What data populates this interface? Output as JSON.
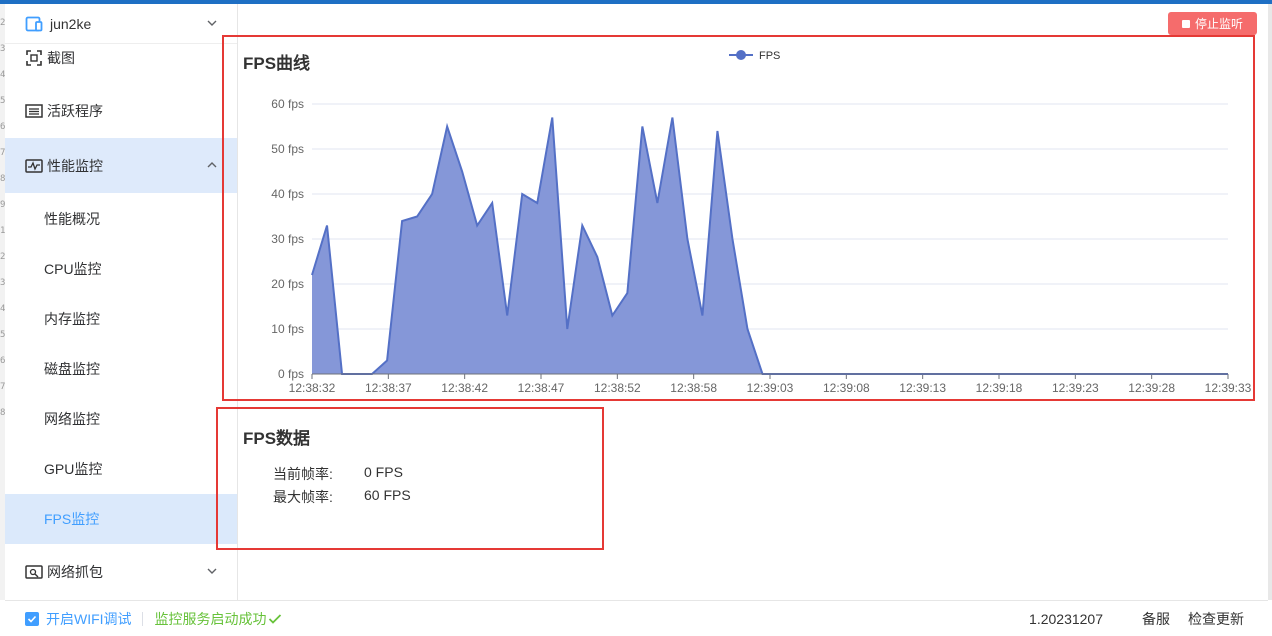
{
  "app": {
    "device_name": "jun2ke",
    "gutter_numbers": [
      "2",
      "3",
      "4",
      "5",
      "6",
      "7",
      "8",
      "9",
      "1",
      "2",
      "3",
      "4",
      "5",
      "6",
      "7",
      "8"
    ]
  },
  "sidebar": {
    "items": [
      {
        "label": "截图",
        "icon": "screenshot-icon"
      },
      {
        "label": "活跃程序",
        "icon": "list-icon"
      },
      {
        "label": "性能监控",
        "icon": "pulse-icon",
        "expanded": true
      },
      {
        "label": "网络抓包",
        "icon": "capture-icon"
      }
    ],
    "subitems": [
      {
        "label": "性能概况"
      },
      {
        "label": "CPU监控"
      },
      {
        "label": "内存监控"
      },
      {
        "label": "磁盘监控"
      },
      {
        "label": "网络监控"
      },
      {
        "label": "GPU监控"
      },
      {
        "label": "FPS监控",
        "active": true
      }
    ]
  },
  "toolbar": {
    "stop_label": "停止监听"
  },
  "chart_panel": {
    "title": "FPS曲线"
  },
  "data_panel": {
    "title": "FPS数据",
    "current_label": "当前帧率:",
    "current_value": "0 FPS",
    "max_label": "最大帧率:",
    "max_value": "60 FPS"
  },
  "statusbar": {
    "wifi_label": "开启WIFI调试",
    "service_status": "监控服务启动成功",
    "version": "1.20231207",
    "record_label": "备服",
    "update_label": "检查更新"
  },
  "colors": {
    "accent": "#409eff",
    "series": "#5470c6",
    "area": "#8597d8",
    "danger": "#f56c6c",
    "success": "#67c23a",
    "highlight": "#e53935"
  },
  "chart_data": {
    "type": "area",
    "title": "",
    "legend": [
      "FPS"
    ],
    "legend_position": "top-center",
    "y_tick_labels": [
      "0 fps",
      "10 fps",
      "20 fps",
      "30 fps",
      "40 fps",
      "50 fps",
      "60 fps"
    ],
    "ylim": [
      0,
      60
    ],
    "x_tick_labels": [
      "12:38:32",
      "12:38:37",
      "12:38:42",
      "12:38:47",
      "12:38:52",
      "12:38:58",
      "12:39:03",
      "12:39:08",
      "12:39:13",
      "12:39:18",
      "12:39:23",
      "12:39:28",
      "12:39:33"
    ],
    "grid": true,
    "series": [
      {
        "name": "FPS",
        "values": [
          22,
          33,
          0,
          0,
          0,
          3,
          34,
          35,
          40,
          55,
          45,
          33,
          38,
          13,
          40,
          38,
          57,
          10,
          33,
          26,
          13,
          18,
          55,
          38,
          57,
          30,
          13,
          54,
          30,
          10,
          0,
          0,
          0,
          0,
          0,
          0,
          0,
          0,
          0,
          0,
          0,
          0,
          0,
          0,
          0,
          0,
          0,
          0,
          0,
          0,
          0,
          0,
          0,
          0,
          0,
          0,
          0,
          0,
          0,
          0,
          0,
          0
        ]
      }
    ]
  }
}
